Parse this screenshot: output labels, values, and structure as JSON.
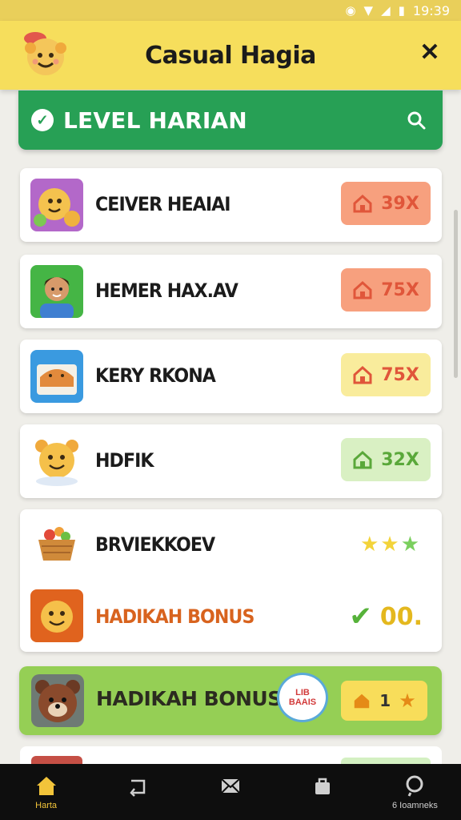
{
  "status_bar": {
    "time": "19:39"
  },
  "app": {
    "title": "Casual Hagia"
  },
  "banner": {
    "title": "LEVEL HARIAN"
  },
  "levels": [
    {
      "label": "CEIVER HEAIAI",
      "badge": "39X",
      "badge_bg": "#f7a07e",
      "badge_fg": "#e0563a",
      "icon": "home-icon"
    },
    {
      "label": "HEMER HAX.AV",
      "badge": "75X",
      "badge_bg": "#f7a07e",
      "badge_fg": "#e0563a",
      "icon": "home-icon"
    },
    {
      "label": "KERY RKONA",
      "badge": "75X",
      "badge_bg": "#f9ec9c",
      "badge_fg": "#e0563a",
      "icon": "home-icon"
    },
    {
      "label": "HDFIK",
      "badge": "32X",
      "badge_bg": "#d9f0c3",
      "badge_fg": "#5aa83a",
      "icon": "home-icon"
    }
  ],
  "bonus_card": {
    "item_label": "BRVIEKKOEV",
    "stars": [
      "★",
      "★",
      "★"
    ],
    "bonus_label": "HADIKAH BONUS",
    "bonus_value": "00.",
    "check": "✔"
  },
  "bonus_banner": {
    "label": "HADIKAH BONUS",
    "bubble_text": "LIB\nBAAIS",
    "badge_value": "1",
    "badge_star": "★"
  },
  "bottom_nav": [
    {
      "label": "Harta",
      "icon": "home-icon",
      "active": true
    },
    {
      "label": "",
      "icon": "back-icon",
      "active": false
    },
    {
      "label": "",
      "icon": "envelope-icon",
      "active": false
    },
    {
      "label": "",
      "icon": "bag-icon",
      "active": false
    },
    {
      "label": "6 Ioamneks",
      "icon": "search-icon",
      "active": false
    }
  ],
  "colors": {
    "appbar": "#f6de5c",
    "banner": "#27a055",
    "bonus_banner": "#95cf55",
    "nav_bg": "#0e0e0e"
  }
}
